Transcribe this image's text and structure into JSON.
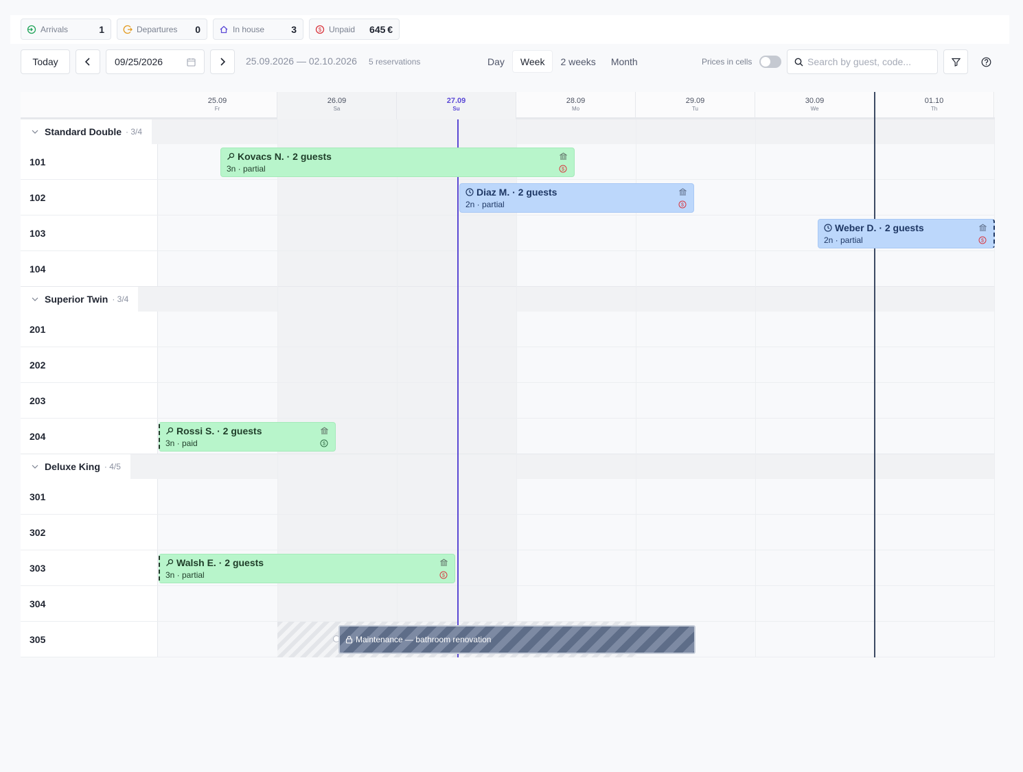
{
  "stats": [
    {
      "label": "Arrivals",
      "value": "1",
      "icon": "arrival-icon",
      "color": "#22a55a"
    },
    {
      "label": "Departures",
      "value": "0",
      "icon": "departure-icon",
      "color": "#e39a1e"
    },
    {
      "label": "In house",
      "value": "3",
      "icon": "house-icon",
      "color": "#5b49d6"
    },
    {
      "label": "Unpaid",
      "value": "645 €",
      "icon": "dollar-icon",
      "color": "#d9363e"
    }
  ],
  "toolbar": {
    "today_label": "Today",
    "date_value": "09/25/2026",
    "range_text": "25.09.2026 — 02.10.2026",
    "reservation_count": "5 reservations",
    "views": [
      "Day",
      "Week",
      "2 weeks",
      "Month"
    ],
    "active_view": "Week",
    "prices_label": "Prices in cells",
    "prices_enabled": false,
    "search_placeholder": "Search by guest, code..."
  },
  "days": [
    {
      "date": "25.09",
      "weekday": "Fr"
    },
    {
      "date": "26.09",
      "weekday": "Sa"
    },
    {
      "date": "27.09",
      "weekday": "Su"
    },
    {
      "date": "28.09",
      "weekday": "Mo"
    },
    {
      "date": "29.09",
      "weekday": "Tu"
    },
    {
      "date": "30.09",
      "weekday": "We"
    },
    {
      "date": "01.10",
      "weekday": "Th"
    }
  ],
  "today": "27.09",
  "groups": [
    {
      "name": "Standard Double",
      "count": "· 3/4",
      "rooms": [
        "101",
        "102",
        "103",
        "104"
      ]
    },
    {
      "name": "Superior Twin",
      "count": "· 3/4",
      "rooms": [
        "201",
        "202",
        "203",
        "204"
      ]
    },
    {
      "name": "Deluxe King",
      "count": "· 4/5",
      "rooms": [
        "301",
        "302",
        "303",
        "304",
        "305"
      ]
    }
  ],
  "reservations": [
    {
      "room": "101",
      "title": "Kovacs N. · 2 guests",
      "subtitle": "3n · partial",
      "status": "checked-in",
      "color": "green",
      "payment": "partial"
    },
    {
      "room": "102",
      "title": "Diaz M. · 2 guests",
      "subtitle": "2n · partial",
      "status": "upcoming",
      "color": "blue",
      "payment": "partial"
    },
    {
      "room": "103",
      "title": "Weber D. · 2 guests",
      "subtitle": "2n · partial",
      "status": "upcoming",
      "color": "blue",
      "payment": "partial"
    },
    {
      "room": "204",
      "title": "Rossi S. · 2 guests",
      "subtitle": "3n · paid",
      "status": "checked-in",
      "color": "green",
      "payment": "paid"
    },
    {
      "room": "303",
      "title": "Walsh E. · 2 guests",
      "subtitle": "3n · partial",
      "status": "checked-in",
      "color": "green",
      "payment": "partial"
    }
  ],
  "block": {
    "room": "305",
    "label": "Maintenance — bathroom renovation"
  }
}
